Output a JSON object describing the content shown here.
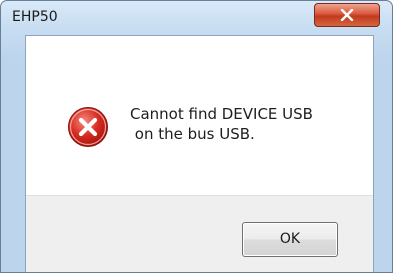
{
  "window": {
    "title": "EHP50",
    "close_icon": "close-x-icon",
    "close_button_color": "#c7432a"
  },
  "dialog": {
    "icon": "error-icon",
    "icon_color": "#d62a1f",
    "message": "Cannot find DEVICE USB\n on the bus USB.",
    "ok_label": "OK"
  }
}
